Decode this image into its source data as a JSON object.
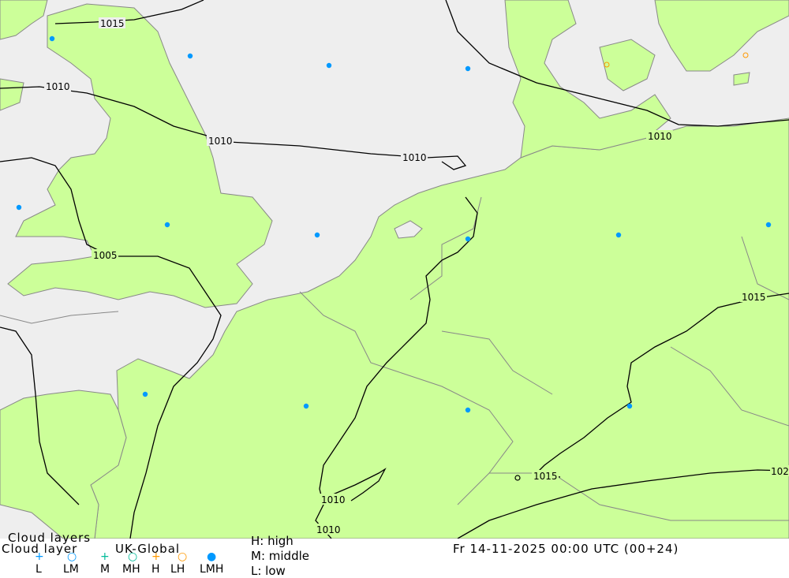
{
  "map": {
    "isobars": [
      {
        "label": "1015"
      },
      {
        "label": "1010"
      },
      {
        "label": "1010"
      },
      {
        "label": "1010"
      },
      {
        "label": "1010"
      },
      {
        "label": "1005"
      },
      {
        "label": "1015"
      },
      {
        "label": "1015"
      },
      {
        "label": "102"
      },
      {
        "label": "1010"
      },
      {
        "label": "1010"
      }
    ],
    "colors": {
      "land": "#ccff99",
      "sea": "#eeeeee",
      "border": "#888888",
      "isobar": "#000000",
      "lmh_marker": "#0099ff",
      "high_marker": "#ff9900"
    }
  },
  "footer": {
    "title_line1": "Cloud layers",
    "title_line2": "Cloud layer",
    "model": "UK-Global",
    "high_key": "H: high",
    "middle_key": "M: middle",
    "low_key": "L: low",
    "datetime": "Fr 14-11-2025 00:00 UTC (00+24)",
    "legend": [
      {
        "code": "L",
        "icon": "plus-icon",
        "color": "#0099ff"
      },
      {
        "code": "LM",
        "icon": "circle-icon",
        "color": "#0099ff"
      },
      {
        "code": "M",
        "icon": "plus-icon",
        "color": "#00bb99"
      },
      {
        "code": "MH",
        "icon": "circle-icon",
        "color": "#00bb99"
      },
      {
        "code": "H",
        "icon": "plus-icon",
        "color": "#ff9900"
      },
      {
        "code": "LH",
        "icon": "circle-icon",
        "color": "#ff9900"
      },
      {
        "code": "LMH",
        "icon": "filled-circle-icon",
        "color": "#0099ff"
      }
    ]
  }
}
